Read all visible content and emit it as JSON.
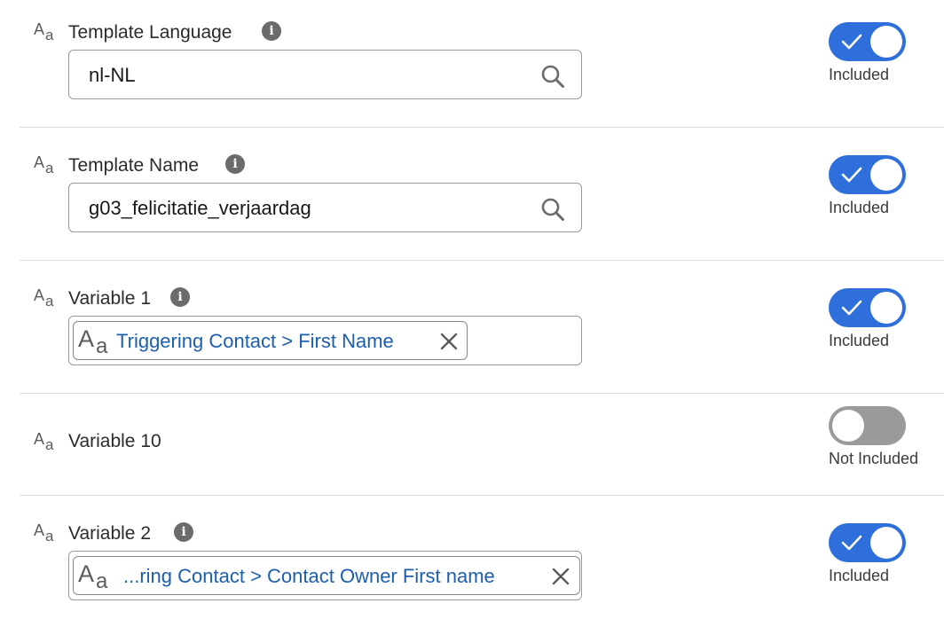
{
  "rows": [
    {
      "label": "Template Language",
      "value": "nl-NL",
      "status": "Included"
    },
    {
      "label": "Template Name",
      "value": "g03_felicitatie_verjaardag",
      "status": "Included"
    },
    {
      "label": "Variable 1",
      "value": "Triggering Contact > First Name",
      "status": "Included"
    },
    {
      "label": "Variable 10",
      "status": "Not Included"
    },
    {
      "label": "Variable 2",
      "value": "...ring Contact > Contact Owner First name",
      "status": "Included"
    }
  ],
  "icons": {
    "text_type_big": "A",
    "text_type_small": "a",
    "info": "i"
  },
  "colors": {
    "toggle_on": "#2e6fdb",
    "toggle_off": "#9a9a9a",
    "pill_text": "#1c5fb0"
  }
}
